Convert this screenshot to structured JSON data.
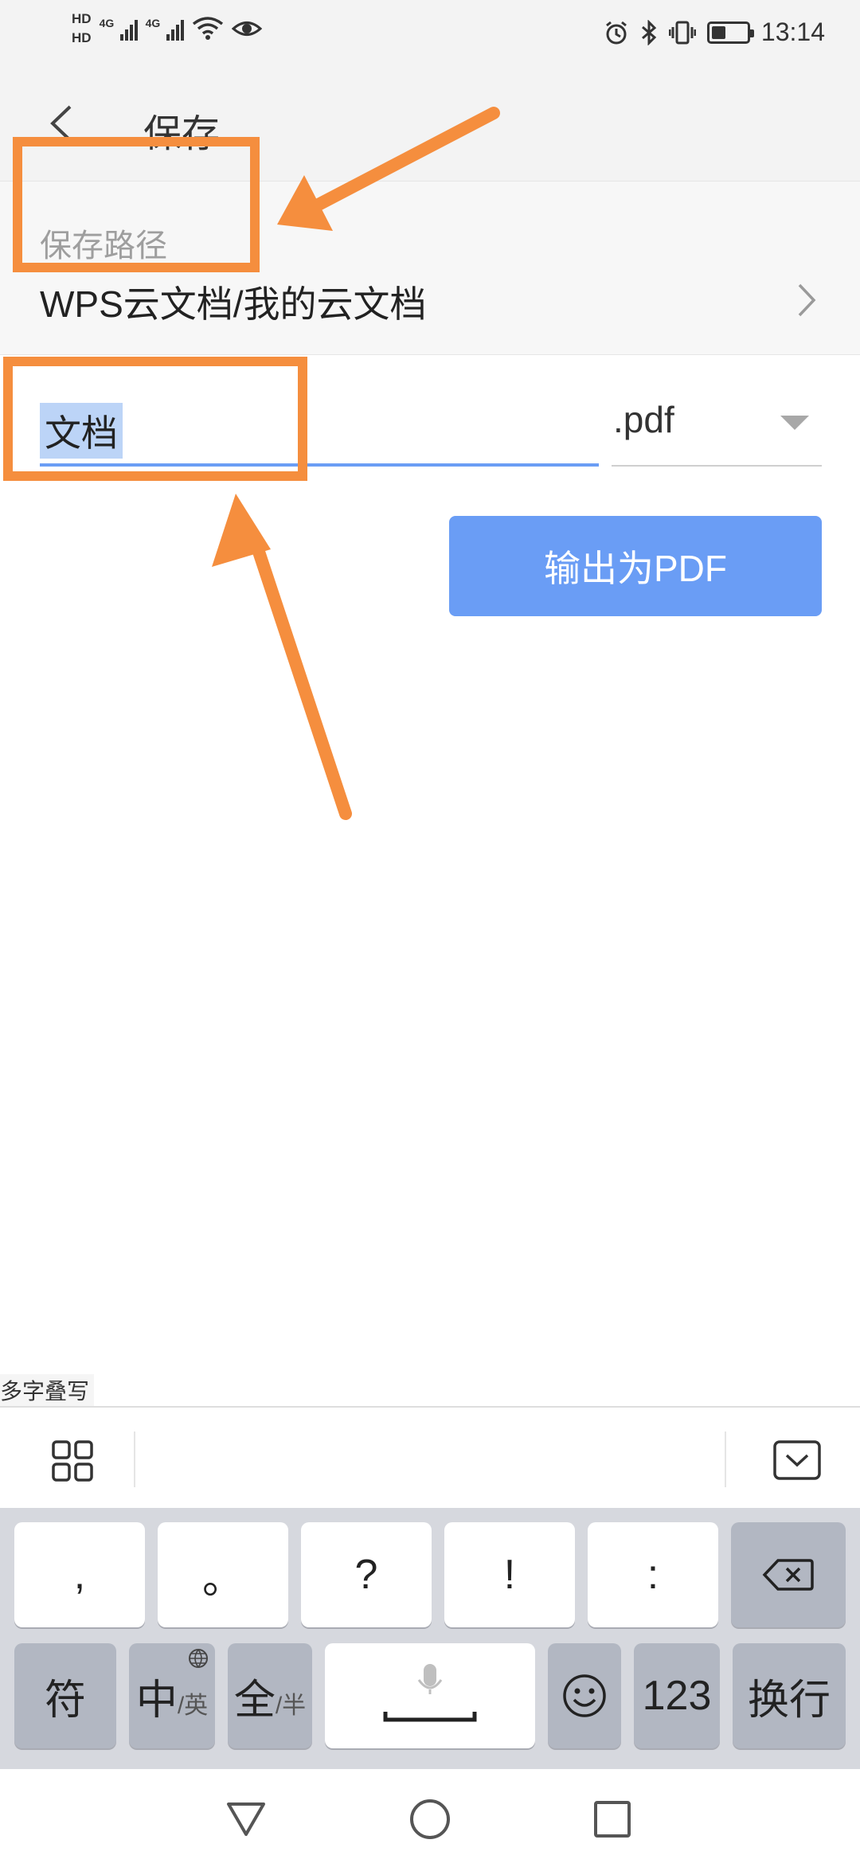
{
  "status_bar": {
    "hd1": "HD",
    "hd2": "HD",
    "net1": "4G",
    "net2": "4G",
    "time": "13:14",
    "battery_level": 0.4
  },
  "header": {
    "title": "保存",
    "back_icon": "chevron-left-icon"
  },
  "save_path": {
    "label": "保存路径",
    "value": "WPS云文档/我的云文档"
  },
  "file": {
    "name_value": "文档",
    "extension": ".pdf"
  },
  "export_button": "输出为PDF",
  "colors": {
    "accent": "#6a9df5",
    "annotation": "#f58e3e",
    "selection": "#bcd4f7"
  },
  "keyboard": {
    "hint": "多字叠写",
    "row1": [
      ",",
      "。",
      "?",
      "!",
      ":"
    ],
    "fu": "符",
    "zhong": "中",
    "ying": "/英",
    "quan": "全",
    "ban": "/半",
    "num": "123",
    "enter": "换行"
  }
}
